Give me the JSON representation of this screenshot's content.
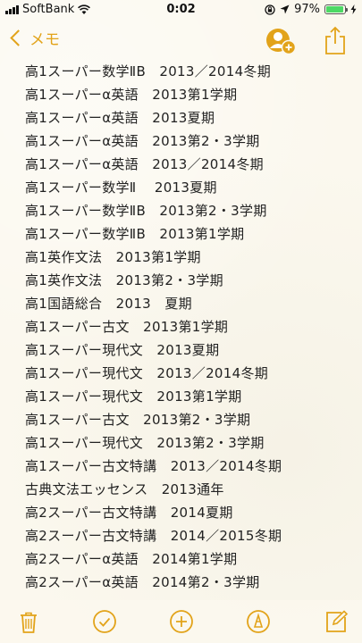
{
  "status_bar": {
    "carrier": "SoftBank",
    "time": "0:02",
    "battery": "97%",
    "battery_level": 0.97
  },
  "nav": {
    "back_label": "メモ",
    "accent": "#e2a31a"
  },
  "note": {
    "lines": [
      "高1スーパー数学ⅡB　2013／2014冬期",
      "高1スーパーα英語　2013第1学期",
      "高1スーパーα英語　2013夏期",
      "高1スーパーα英語　2013第2・3学期",
      "高1スーパーα英語　2013／2014冬期",
      "高1スーパー数学Ⅱ　 2013夏期",
      "高1スーパー数学ⅡB　2013第2・3学期",
      "高1スーパー数学ⅡB　2013第1学期",
      "高1英作文法　2013第1学期",
      "高1英作文法　2013第2・3学期",
      "高1国語総合　2013　夏期",
      "高1スーパー古文　2013第1学期",
      "高1スーパー現代文　2013夏期",
      "高1スーパー現代文　2013／2014冬期",
      "高1スーパー現代文　2013第1学期",
      "高1スーパー古文　2013第2・3学期",
      "高1スーパー現代文　2013第2・3学期",
      "高1スーパー古文特講　2013／2014冬期",
      "古典文法エッセンス　2013通年",
      "高2スーパー古文特講　2014夏期",
      "高2スーパー古文特講　2014／2015冬期",
      "高2スーパーα英語　2014第1学期",
      "高2スーパーα英語　2014第2・3学期"
    ]
  },
  "icons": {
    "accent": "#e2a31a"
  }
}
